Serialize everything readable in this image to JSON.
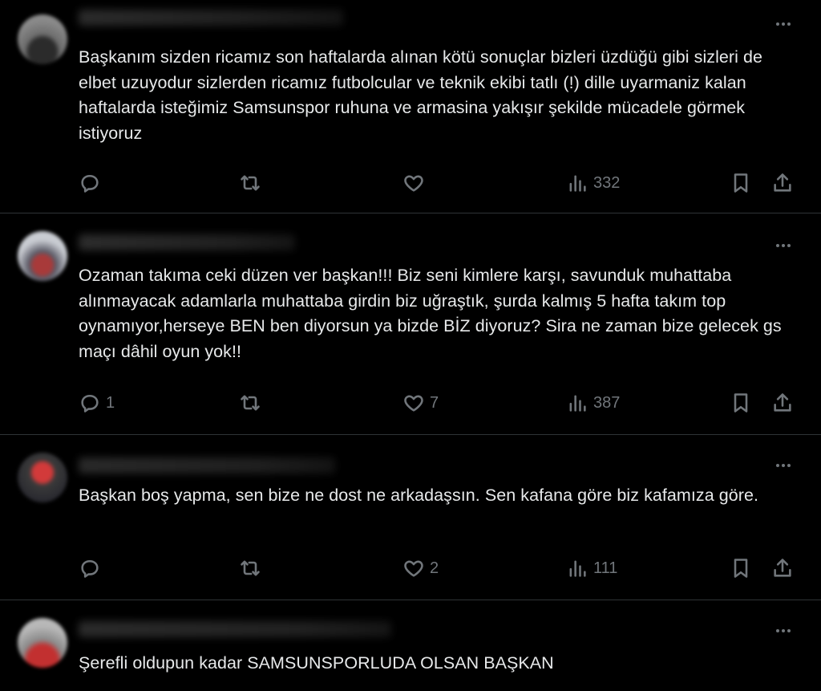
{
  "tweets": [
    {
      "text": "Başkanım sizden ricamız son haftalarda alınan kötü sonuçlar bizleri üzdüğü gibi sizleri de elbet uzuyodur sizlerden ricamız futbolcular ve teknik ekibi tatlı (!) dille uyarmaniz kalan haftalarda isteğimiz Samsunspor ruhuna ve armasina yakışır şekilde mücadele görmek istiyoruz",
      "replies": "",
      "retweets": "",
      "likes": "",
      "views": "332"
    },
    {
      "text": "Ozaman takıma ceki düzen ver başkan!!! Biz seni kimlere karşı, savunduk muhattaba alınmayacak adamlarla muhattaba girdin biz uğraştık,  şurda kalmış 5 hafta takım top oynamıyor,herseye BEN ben diyorsun ya bizde  BİZ diyoruz? Sira ne zaman bize gelecek   gs maçı dâhil oyun yok!!",
      "replies": "1",
      "retweets": "",
      "likes": "7",
      "views": "387"
    },
    {
      "text": "Başkan boş yapma, sen bize ne dost ne arkadaşsın. Sen kafana göre biz kafamıza göre.",
      "replies": "",
      "retweets": "",
      "likes": "2",
      "views": "111"
    },
    {
      "text": "Şerefli oldupun kadar SAMSUNSPORLUDA OLSAN BAŞKAN"
    }
  ],
  "icons": {
    "more": "more-horizontal-icon",
    "reply": "reply-icon",
    "retweet": "retweet-icon",
    "like": "heart-icon",
    "views": "views-icon",
    "bookmark": "bookmark-icon",
    "share": "share-icon"
  },
  "colors": {
    "background": "#000000",
    "text": "#e7e9ea",
    "muted": "#71767b",
    "divider": "#2f3336"
  }
}
